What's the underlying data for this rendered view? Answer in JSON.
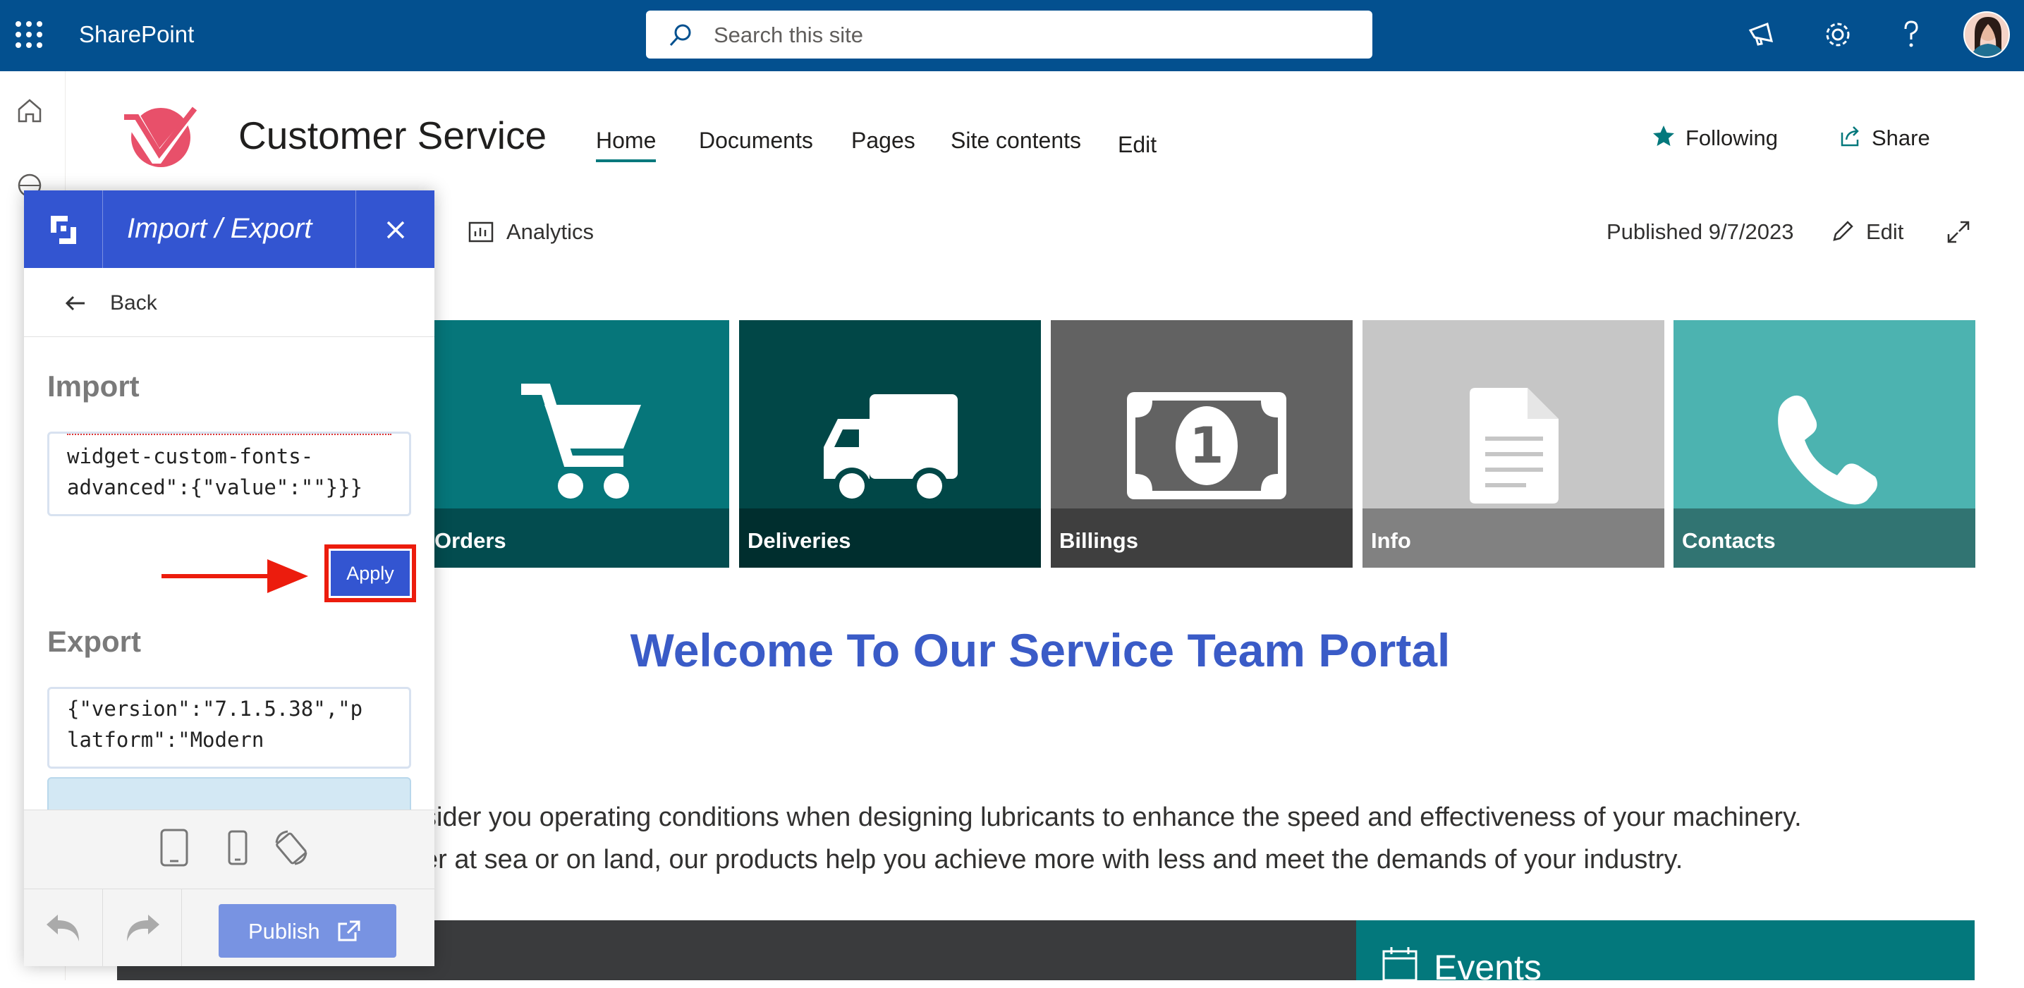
{
  "suite": {
    "brand": "SharePoint",
    "search_placeholder": "Search this site"
  },
  "site": {
    "title": "Customer Service",
    "nav": [
      "Home",
      "Documents",
      "Pages",
      "Site contents",
      "Edit"
    ],
    "following_label": "Following",
    "share_label": "Share"
  },
  "command_bar": {
    "analytics_label": "Analytics",
    "published": "Published 9/7/2023",
    "edit_label": "Edit"
  },
  "tiles": [
    {
      "label": "Orders",
      "color": "#06767a",
      "icon": "cart-icon"
    },
    {
      "label": "Deliveries",
      "color": "#014747",
      "icon": "truck-icon"
    },
    {
      "label": "Billings",
      "color": "#626262",
      "icon": "banknote-icon"
    },
    {
      "label": "Info",
      "color": "#c6c6c6",
      "icon": "document-icon"
    },
    {
      "label": "Contacts",
      "color": "#4cb3b0",
      "icon": "phone-icon"
    }
  ],
  "welcome": "Welcome To Our Service Team Portal",
  "paragraph": [
    "sider you operating conditions when designing lubricants to enhance the speed and effectiveness of your machinery.",
    "er at sea or on land, our products help you achieve more with less and meet the demands of your industry."
  ],
  "events_label": "Events",
  "panel": {
    "title": "Import / Export",
    "back_label": "Back",
    "import_heading": "Import",
    "import_lines": [
      "widget-custom-fonts-",
      "advanced\":{\"value\":\"\"}}}"
    ],
    "apply_label": "Apply",
    "export_heading": "Export",
    "export_lines": [
      "{\"version\":\"7.1.5.38\",\"p",
      "latform\":\"Modern"
    ],
    "publish_label": "Publish"
  },
  "colors": {
    "suite_bar": "#03508f",
    "panel_accent": "#3355d1",
    "highlight": "#ec1c0d",
    "welcome": "#3a5bc7",
    "teal": "#03787c"
  }
}
